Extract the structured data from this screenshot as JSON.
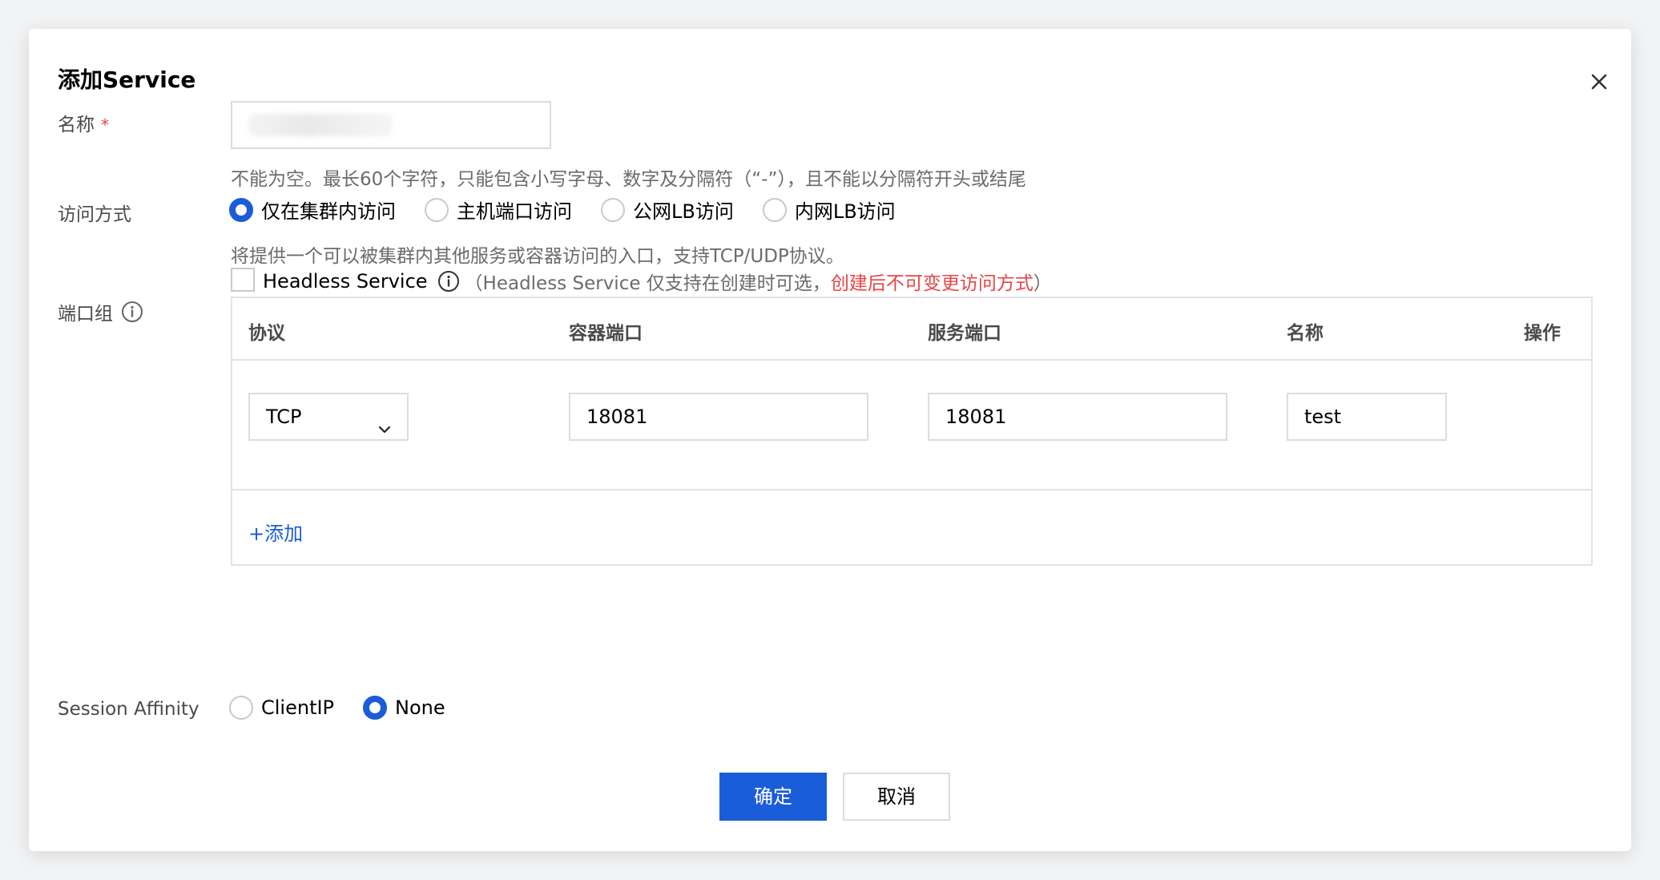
{
  "dialog": {
    "title": "添加Service",
    "close_icon": "close-icon"
  },
  "name_field": {
    "label": "名称",
    "required_mark": "*",
    "value": "",
    "hint": "不能为空。最长60个字符，只能包含小写字母、数字及分隔符（“-”），且不能以分隔符开头或结尾"
  },
  "access_mode": {
    "label": "访问方式",
    "options": [
      {
        "label": "仅在集群内访问",
        "checked": true
      },
      {
        "label": "主机端口访问",
        "checked": false
      },
      {
        "label": "公网LB访问",
        "checked": false
      },
      {
        "label": "内网LB访问",
        "checked": false
      }
    ],
    "description": "将提供一个可以被集群内其他服务或容器访问的入口，支持TCP/UDP协议。",
    "headless": {
      "label": "Headless Service",
      "checked": false,
      "note_prefix": "（Headless Service 仅支持在创建时可选，",
      "note_warning": "创建后不可变更访问方式",
      "note_suffix": "）"
    }
  },
  "port_group": {
    "label": "端口组",
    "columns": [
      "协议",
      "容器端口",
      "服务端口",
      "名称",
      "操作"
    ],
    "rows": [
      {
        "protocol": "TCP",
        "container_port": "18081",
        "service_port": "18081",
        "name": "test"
      }
    ],
    "add_label": "+添加"
  },
  "session_affinity": {
    "label": "Session Affinity",
    "options": [
      {
        "label": "ClientIP",
        "checked": false
      },
      {
        "label": "None",
        "checked": true
      }
    ]
  },
  "footer": {
    "confirm_label": "确定",
    "cancel_label": "取消"
  },
  "colors": {
    "primary": "#1b5cd8",
    "danger": "#e54545"
  }
}
